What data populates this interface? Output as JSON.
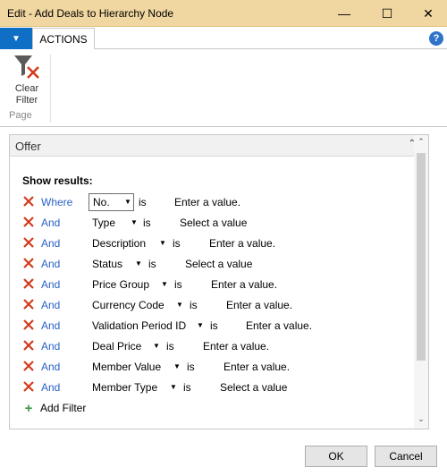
{
  "window": {
    "title": "Edit - Add Deals to Hierarchy Node"
  },
  "ribbon": {
    "tab_actions": "ACTIONS",
    "clear_filter_line1": "Clear",
    "clear_filter_line2": "Filter",
    "group_page": "Page"
  },
  "fasttab": {
    "title": "Offer"
  },
  "filters": {
    "show_results": "Show results:",
    "rows": [
      {
        "conj": "Where",
        "field": "No.",
        "op": "is",
        "value": "Enter a value."
      },
      {
        "conj": "And",
        "field": "Type",
        "op": "is",
        "value": "Select a value"
      },
      {
        "conj": "And",
        "field": "Description",
        "op": "is",
        "value": "Enter a value."
      },
      {
        "conj": "And",
        "field": "Status",
        "op": "is",
        "value": "Select a value"
      },
      {
        "conj": "And",
        "field": "Price Group",
        "op": "is",
        "value": "Enter a value."
      },
      {
        "conj": "And",
        "field": "Currency Code",
        "op": "is",
        "value": "Enter a value."
      },
      {
        "conj": "And",
        "field": "Validation Period ID",
        "op": "is",
        "value": "Enter a value."
      },
      {
        "conj": "And",
        "field": "Deal Price",
        "op": "is",
        "value": "Enter a value."
      },
      {
        "conj": "And",
        "field": "Member Value",
        "op": "is",
        "value": "Enter a value."
      },
      {
        "conj": "And",
        "field": "Member Type",
        "op": "is",
        "value": "Select a value"
      }
    ],
    "add_filter": "Add Filter"
  },
  "buttons": {
    "ok": "OK",
    "cancel": "Cancel"
  },
  "colors": {
    "titlebar": "#f0d6a0",
    "link": "#2a62c8",
    "remove": "#d23c1e",
    "add": "#3a9a44",
    "app_menu": "#0e6fc5"
  }
}
